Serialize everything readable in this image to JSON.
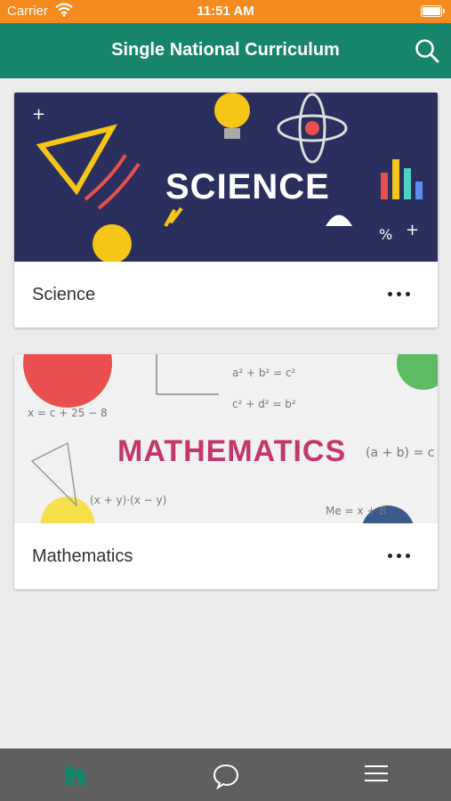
{
  "status_bar": {
    "carrier": "Carrier",
    "time": "11:51 AM"
  },
  "app_bar": {
    "title": "Single National Curriculum"
  },
  "cards": [
    {
      "banner_text": "SCIENCE",
      "label": "Science"
    },
    {
      "banner_text": "MATHEMATICS",
      "label": "Mathematics"
    }
  ],
  "colors": {
    "status": "#f58a1f",
    "appbar": "#17856c",
    "tabbar": "#5f5f5f",
    "active_tab": "#17856c"
  },
  "tabs": [
    {
      "icon": "home-icon",
      "active": true
    },
    {
      "icon": "chat-icon",
      "active": false
    },
    {
      "icon": "menu-icon",
      "active": false
    }
  ]
}
